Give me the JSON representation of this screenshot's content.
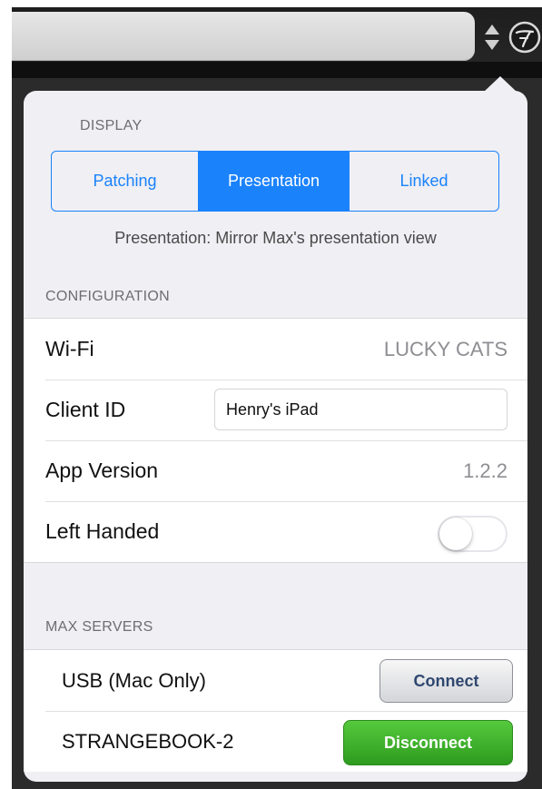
{
  "toolbar": {
    "stepper_icon": "up-down-stepper-icon",
    "logo_icon": "app-logo-icon"
  },
  "display": {
    "header": "DISPLAY",
    "segments": [
      {
        "label": "Patching",
        "selected": false
      },
      {
        "label": "Presentation",
        "selected": true
      },
      {
        "label": "Linked",
        "selected": false
      }
    ],
    "description": "Presentation: Mirror Max's presentation view"
  },
  "configuration": {
    "header": "CONFIGURATION",
    "wifi_label": "Wi-Fi",
    "wifi_value": "LUCKY CATS",
    "client_id_label": "Client ID",
    "client_id_value": "Henry's iPad",
    "app_version_label": "App Version",
    "app_version_value": "1.2.2",
    "left_handed_label": "Left Handed",
    "left_handed_on": false
  },
  "max_servers": {
    "header": "MAX SERVERS",
    "servers": [
      {
        "name": "USB (Mac Only)",
        "action": "Connect"
      },
      {
        "name": "STRANGEBOOK-2",
        "action": "Disconnect"
      }
    ]
  },
  "colors": {
    "accent": "#1a82fb",
    "connected_green": "#3cb52a",
    "group_background": "#efeff4"
  }
}
